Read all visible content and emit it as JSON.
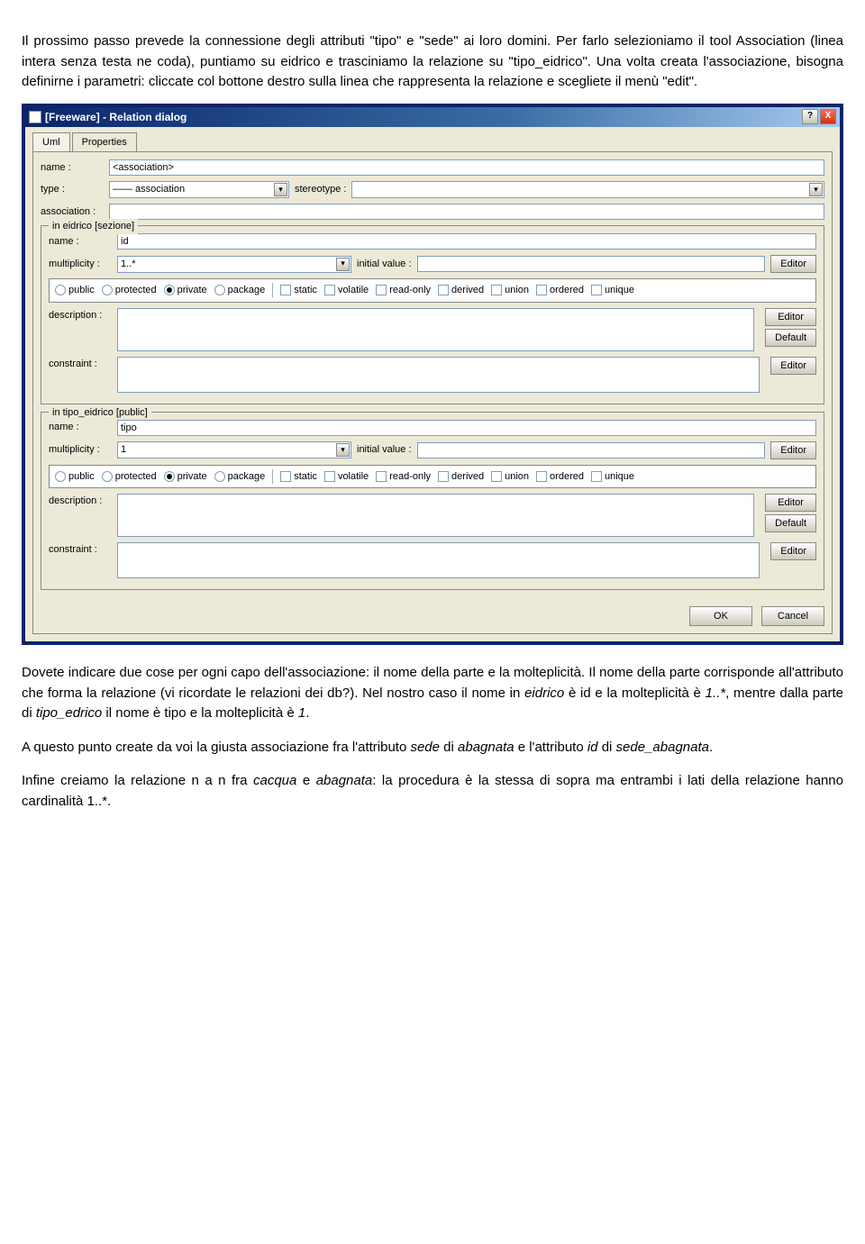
{
  "doc": {
    "p1": "Il prossimo passo prevede la connessione degli attributi \"tipo\" e \"sede\" ai loro domini. Per farlo selezioniamo il tool Association (linea intera senza testa ne coda), puntiamo su eidrico e trasciniamo la relazione su \"tipo_eidrico\". Una volta creata l'associazione, bisogna definirne i parametri: cliccate col bottone destro sulla linea che rappresenta la relazione e scegliete il menù \"edit\".",
    "p2a": "Dovete indicare due cose per ogni capo dell'associazione: il nome della parte e la molteplicità. Il nome della parte corrisponde all'attributo che forma la relazione (vi ricordate le relazioni dei db?). Nel nostro caso il nome in ",
    "p2b": "eidrico",
    "p2c": " è id e la molteplicità è ",
    "p2d": "1..*",
    "p2e": ", mentre dalla parte di ",
    "p2f": "tipo_edrico",
    "p2g": " il nome è tipo e la molteplicità è ",
    "p2h": "1",
    "p2i": ".",
    "p3a": "A questo punto create da voi la giusta associazione fra l'attributo ",
    "p3b": "sede",
    "p3c": " di ",
    "p3d": "abagnata",
    "p3e": " e l'attributo ",
    "p3f": "id",
    "p3g": " di ",
    "p3h": "sede_abagnata",
    "p3i": ".",
    "p4a": "Infine creiamo la relazione n a n fra ",
    "p4b": "cacqua",
    "p4c": " e ",
    "p4d": "abagnata",
    "p4e": ": la procedura è la stessa di sopra ma entrambi i lati della relazione hanno cardinalità 1..*."
  },
  "dialog": {
    "title": "[Freeware] - Relation dialog",
    "help": "?",
    "close": "X",
    "tabs": {
      "uml": "Uml",
      "properties": "Properties"
    },
    "labels": {
      "name": "name :",
      "type": "type :",
      "stereotype": "stereotype :",
      "association": "association :",
      "multiplicity": "multiplicity :",
      "initial_value": "initial value :",
      "description": "description :",
      "constraint": "constraint :"
    },
    "buttons": {
      "editor": "Editor",
      "default": "Default",
      "ok": "OK",
      "cancel": "Cancel"
    },
    "top": {
      "name_value": "<association>",
      "type_value": "—— association"
    },
    "groupA": {
      "legend": "in eidrico  [sezione]",
      "name_value": "id",
      "multiplicity_value": "1..*"
    },
    "groupB": {
      "legend": "in tipo_eidrico  [public]",
      "name_value": "tipo",
      "multiplicity_value": "1"
    },
    "access": {
      "public": "public",
      "protected": "protected",
      "private": "private",
      "package": "package"
    },
    "modifiers": {
      "static": "static",
      "volatile": "volatile",
      "readonly": "read-only",
      "derived": "derived",
      "union": "union",
      "ordered": "ordered",
      "unique": "unique"
    }
  }
}
